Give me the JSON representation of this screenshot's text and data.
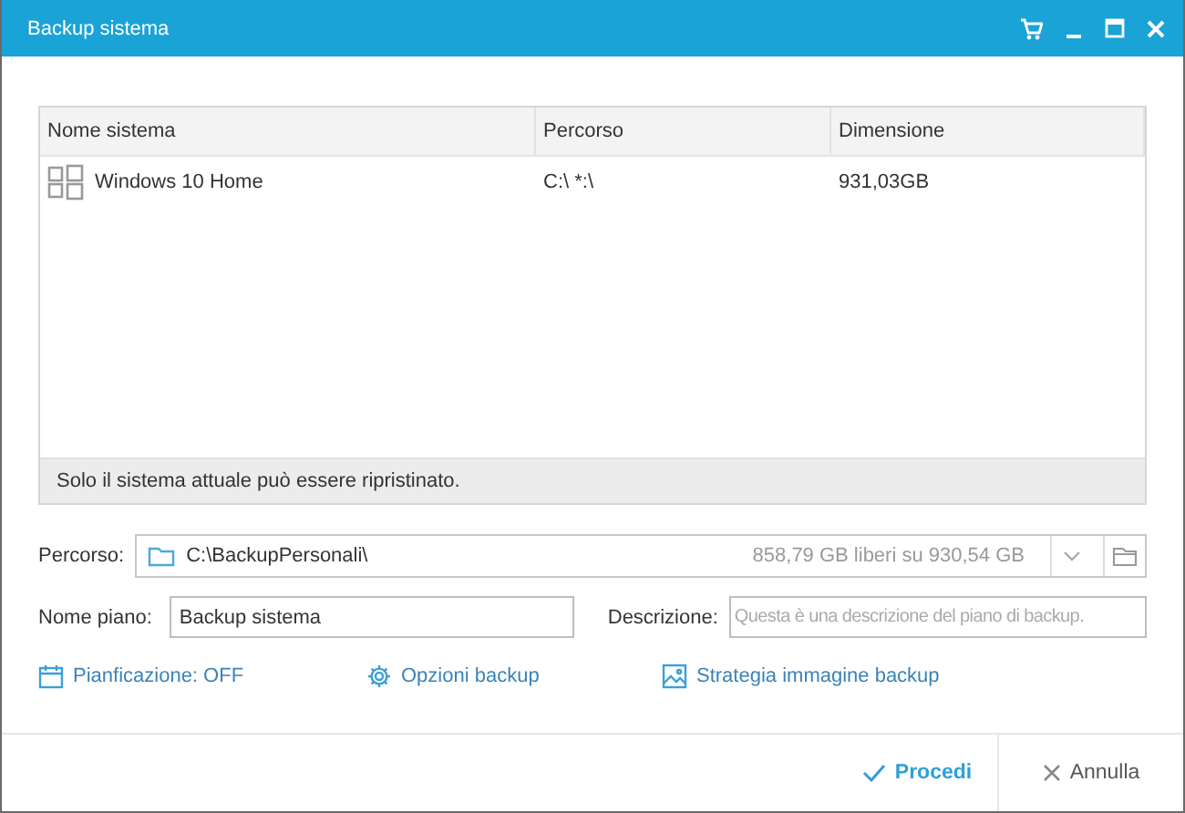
{
  "window": {
    "title": "Backup sistema"
  },
  "table": {
    "columns": [
      "Nome sistema",
      "Percorso",
      "Dimensione"
    ],
    "rows": [
      {
        "name": "Windows 10 Home",
        "path": "C:\\ *:\\",
        "size": "931,03GB"
      }
    ],
    "note": "Solo il sistema attuale può essere ripristinato."
  },
  "destination": {
    "label": "Percorso:",
    "value": "C:\\BackupPersonali\\",
    "free_space": "858,79 GB liberi su 930,54 GB"
  },
  "plan_name": {
    "label": "Nome piano:",
    "value": "Backup sistema"
  },
  "description": {
    "label": "Descrizione:",
    "placeholder": "Questa è una descrizione del piano di backup."
  },
  "links": [
    {
      "kind": "schedule",
      "label": "Pianficazione: OFF"
    },
    {
      "kind": "options",
      "label": "Opzioni backup"
    },
    {
      "kind": "image",
      "label": "Strategia immagine backup"
    }
  ],
  "buttons": [
    {
      "kind": "proceed",
      "label": "Procedi"
    },
    {
      "kind": "cancel",
      "label": "Annulla"
    }
  ]
}
